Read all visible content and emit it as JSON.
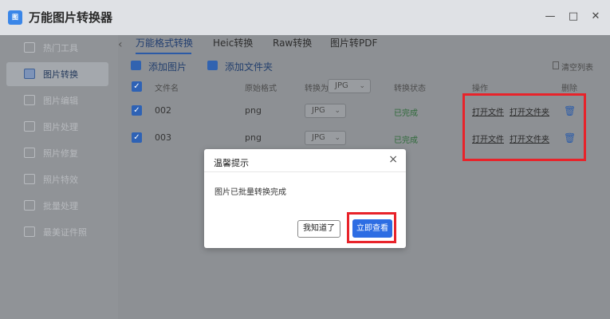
{
  "app": {
    "logo_text": "图",
    "title": "万能图片转换器"
  },
  "window": {
    "minimize": "—",
    "maximize": "□",
    "close": "✕"
  },
  "sidebar": {
    "items": [
      {
        "label": "热门工具",
        "active": false
      },
      {
        "label": "图片转换",
        "active": true
      },
      {
        "label": "图片编辑",
        "active": false
      },
      {
        "label": "图片处理",
        "active": false
      },
      {
        "label": "照片修复",
        "active": false
      },
      {
        "label": "照片特效",
        "active": false
      },
      {
        "label": "批量处理",
        "active": false
      },
      {
        "label": "最美证件照",
        "active": false
      }
    ]
  },
  "tabs": [
    {
      "label": "万能格式转换",
      "active": true
    },
    {
      "label": "Heic转换",
      "active": false
    },
    {
      "label": "Raw转换",
      "active": false
    },
    {
      "label": "图片转PDF",
      "active": false
    }
  ],
  "toolbar": {
    "add_image": "添加图片",
    "add_folder": "添加文件夹",
    "clear_list": "清空列表"
  },
  "table": {
    "headers": {
      "filename": "文件名",
      "original_format": "原始格式",
      "convert_to": "转换为",
      "status": "转换状态",
      "actions": "操作",
      "delete": "删除"
    },
    "header_format": "JPG",
    "rows": [
      {
        "filename": "002",
        "format": "png",
        "target": "JPG",
        "status": "已完成",
        "open_file": "打开文件",
        "open_folder": "打开文件夹"
      },
      {
        "filename": "003",
        "format": "png",
        "target": "JPG",
        "status": "已完成",
        "open_file": "打开文件",
        "open_folder": "打开文件夹"
      }
    ]
  },
  "dialog": {
    "title": "温馨提示",
    "message": "图片已批量转换完成",
    "btn_know": "我知道了",
    "btn_view": "立即查看"
  },
  "colors": {
    "accent": "#2d6de3",
    "highlight": "#e8232a"
  }
}
